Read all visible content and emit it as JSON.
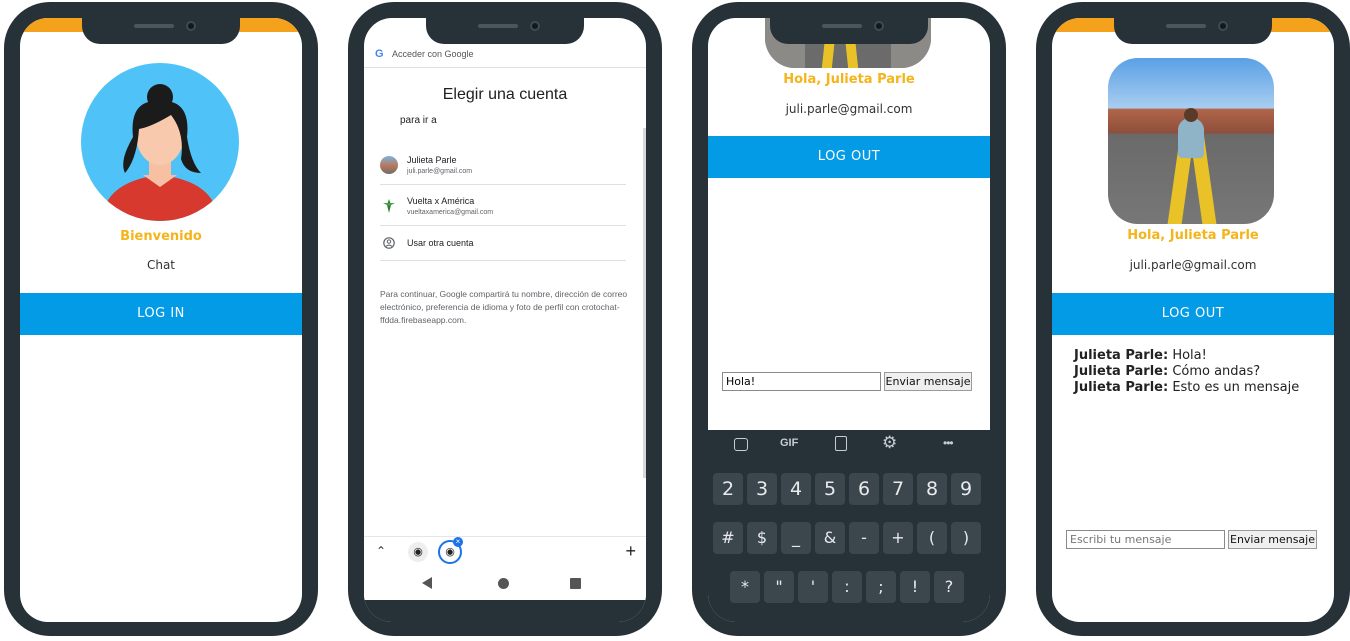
{
  "screens": [
    {
      "welcome": "Bienvenido",
      "subtitle": "Chat",
      "button": "LOG IN"
    },
    {
      "header": "Acceder con Google",
      "title": "Elegir una cuenta",
      "subtitle": "para ir a",
      "accounts": [
        {
          "name": "Julieta Parle",
          "email": "juli.parle@gmail.com"
        },
        {
          "name": "Vuelta x América",
          "email": "vueltaxamerica@gmail.com"
        }
      ],
      "other": "Usar otra cuenta",
      "note": "Para continuar, Google compartirá tu nombre, dirección de correo electrónico, preferencia de idioma y foto de perfil con crotochat-ffdda.firebaseapp.com."
    },
    {
      "greeting": "Hola, Julieta Parle",
      "email": "juli.parle@gmail.com",
      "button": "LOG OUT",
      "input_value": "Hola!",
      "send": "Enviar mensaje",
      "keys_row1": [
        "2",
        "3",
        "4",
        "5",
        "6",
        "7",
        "8",
        "9"
      ],
      "keys_row2": [
        "#",
        "$",
        "_",
        "&",
        "-",
        "+",
        "(",
        ")"
      ],
      "keys_row3": [
        "*",
        "\"",
        "'",
        ":",
        ";",
        "!",
        "?"
      ],
      "toolbar": [
        "GIF",
        "•••"
      ]
    },
    {
      "greeting": "Hola, Julieta Parle",
      "email": "juli.parle@gmail.com",
      "button": "LOG OUT",
      "messages": [
        {
          "author": "Julieta Parle:",
          "text": "Hola!"
        },
        {
          "author": "Julieta Parle:",
          "text": "Cómo andas?"
        },
        {
          "author": "Julieta Parle:",
          "text": "Esto es un mensaje"
        }
      ],
      "input_placeholder": "Escribi tu mensaje",
      "send": "Enviar mensaje"
    }
  ],
  "colors": {
    "accent": "#f4b41a",
    "topbar": "#f4a21c",
    "button": "#039be5",
    "frame": "#263238"
  }
}
